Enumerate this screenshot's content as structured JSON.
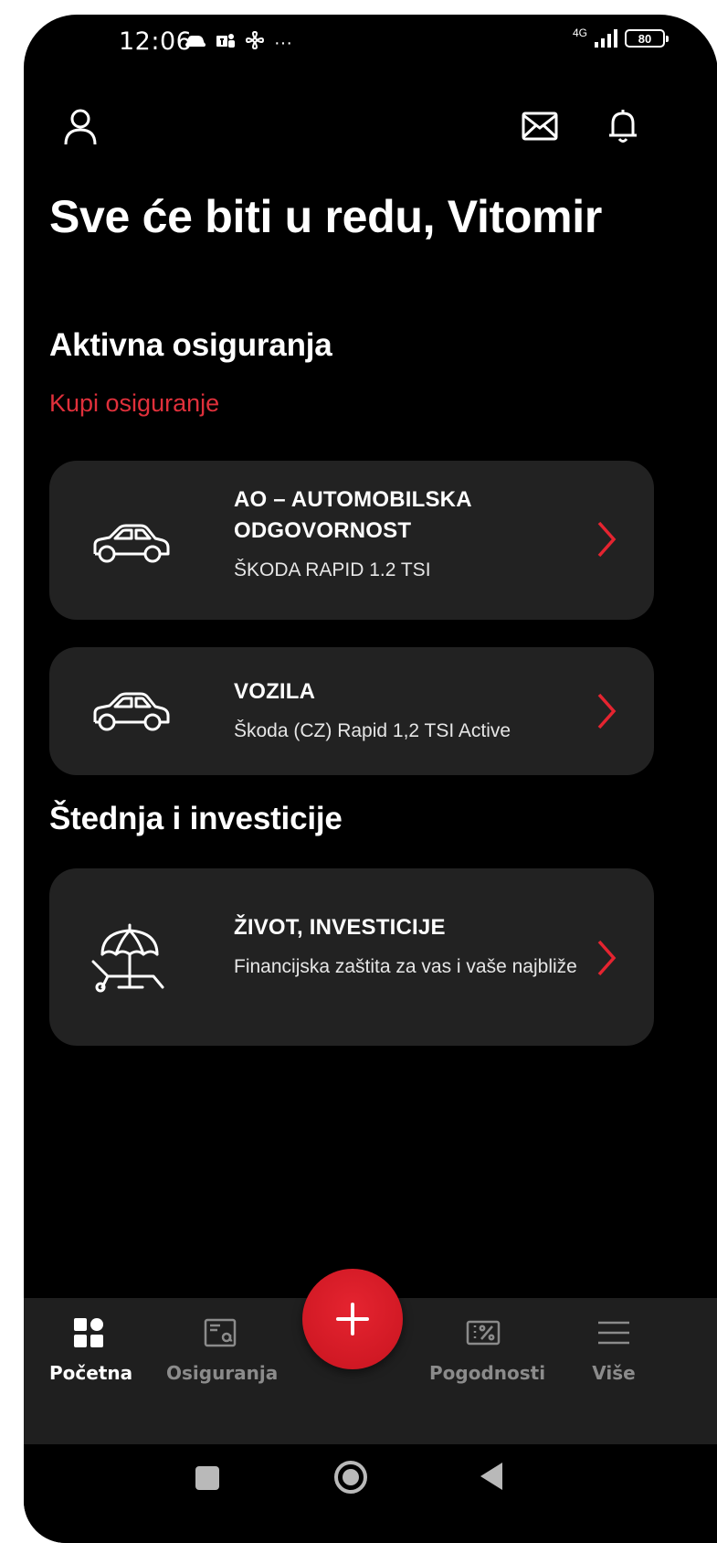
{
  "status_bar": {
    "time": "12:06",
    "left_icons": [
      "car-notification-icon",
      "teams-icon",
      "fan-icon",
      "more-dots-icon"
    ],
    "more_dots": "···",
    "network": "4G",
    "battery": "80"
  },
  "header": {
    "greeting": "Sve će biti u redu, Vitomir",
    "icons": [
      "profile-icon",
      "mail-icon",
      "bell-icon"
    ]
  },
  "sections": {
    "active": {
      "title": "Aktivna osiguranja",
      "buy_link": "Kupi osiguranje",
      "cards": [
        {
          "icon": "car-icon",
          "title": "AO – AUTOMOBILSKA ODGOVORNOST",
          "subtitle": "ŠKODA RAPID 1.2 TSI"
        },
        {
          "icon": "car-icon",
          "title": "VOZILA",
          "subtitle": "Škoda (CZ) Rapid 1,2 TSI Active"
        }
      ]
    },
    "savings": {
      "title": "Štednja i investicije",
      "cards": [
        {
          "icon": "beach-umbrella-icon",
          "title": "ŽIVOT, INVESTICIJE",
          "subtitle": "Financijska zaštita za vas i vaše najbliže"
        }
      ]
    }
  },
  "bottom_nav": {
    "items": [
      {
        "label": "Početna",
        "icon": "home-grid-icon",
        "active": true
      },
      {
        "label": "Osiguranja",
        "icon": "policy-document-icon",
        "active": false
      },
      {
        "label": "Pogodnosti",
        "icon": "discount-ticket-icon",
        "active": false
      },
      {
        "label": "Više",
        "icon": "menu-icon",
        "active": false
      }
    ],
    "fab_icon": "plus-icon"
  },
  "colors": {
    "background": "#000000",
    "card": "#222222",
    "accent": "#e0303b",
    "nav_inactive": "#8b8b8b"
  }
}
